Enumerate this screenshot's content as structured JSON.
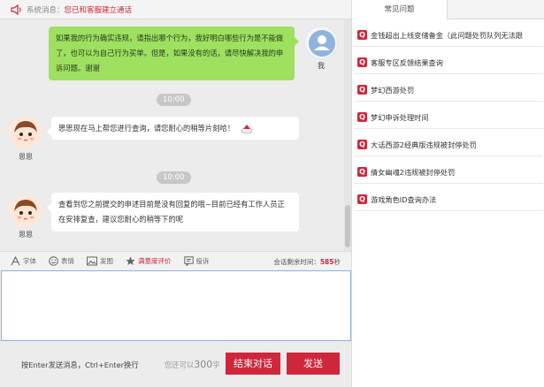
{
  "system": {
    "label": "系统消息：",
    "message": "您已和客服建立通话",
    "icon": "speaker-icon"
  },
  "messages": [
    {
      "from": "me",
      "nickname": "我",
      "lines": [
        "如果我的行为确实违规，请指出哪个行为，我好明白哪些行为是不能做",
        "了，也可以为自己行为买单。但是，如果没有的话，请尽快解决我的申",
        "诉问题。谢谢"
      ]
    },
    {
      "time": "10:00"
    },
    {
      "from": "cs",
      "nickname": "思思",
      "text": "思思现在马上帮您进行查询，请您耐心的稍等片刻哈！"
    },
    {
      "time": "10:00"
    },
    {
      "from": "cs",
      "nickname": "思思",
      "lines": [
        "查看到您之前提交的申述目前是没有回复的哦~目前已经有工作人员正",
        "在安排复查，建议您耐心的稍等下的呢"
      ]
    }
  ],
  "toolbar": {
    "font": "字体",
    "emoji": "表情",
    "image": "发图",
    "rating": "满意度评价",
    "complaint": "投诉",
    "timer_label": "会话剩余时间：",
    "timer_value": "585",
    "timer_unit": "秒"
  },
  "input": {
    "value": "",
    "placeholder": ""
  },
  "bottom": {
    "hint": "按Enter发送消息，Ctrl+Enter换行",
    "remain_prefix": "您还可以",
    "remain_count": "300",
    "remain_suffix": "字",
    "end_button": "结束对话",
    "send_button": "发送"
  },
  "faq": {
    "tab": "常见问题",
    "items": [
      "金钱超出上线变储备金（此问题处罚队列无法跟",
      "客服专区反馈结果查询",
      "梦幻西游处罚",
      "梦幻申诉处理时间",
      "大话西游2经典版违规被封停处罚",
      "倩女幽魂2违规被封停处罚",
      "游戏角色ID查询办法"
    ]
  },
  "colors": {
    "accent": "#d0263c",
    "my_bubble": "#9ee060",
    "cs_bubble": "#ffffff",
    "time_pill": "#c7c7c7"
  }
}
